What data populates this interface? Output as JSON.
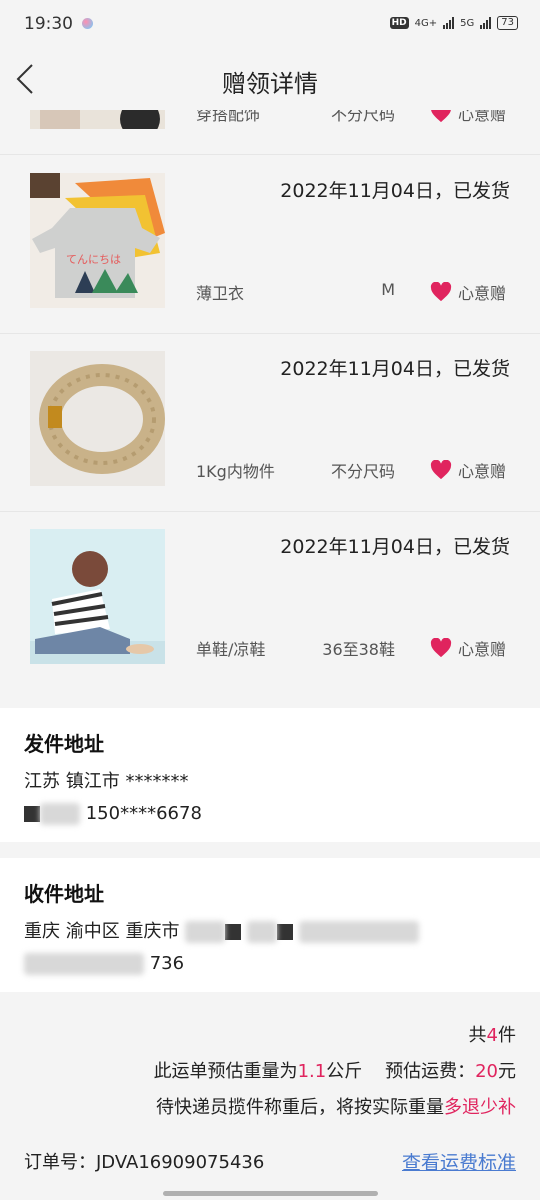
{
  "status": {
    "time": "19:30",
    "hd": "HD",
    "net1": "4G+",
    "net2": "5G",
    "battery": "73"
  },
  "nav": {
    "title": "赠领详情"
  },
  "items": [
    {
      "date": "",
      "name": "穿搭配饰",
      "size": "不分尺码",
      "gift": "心意赠"
    },
    {
      "date": "2022年11月04日，已发货",
      "name": "薄卫衣",
      "size": "M",
      "gift": "心意赠"
    },
    {
      "date": "2022年11月04日，已发货",
      "name": "1Kg内物件",
      "size": "不分尺码",
      "gift": "心意赠"
    },
    {
      "date": "2022年11月04日，已发货",
      "name": "单鞋/凉鞋",
      "size": "36至38鞋",
      "gift": "心意赠"
    }
  ],
  "sender": {
    "title": "发件地址",
    "line1": "江苏 镇江市 *******",
    "phone": "150****6678"
  },
  "receiver": {
    "title": "收件地址",
    "line1": "重庆 渝中区 重庆市",
    "phone_tail": "736"
  },
  "summary": {
    "count_prefix": "共",
    "count": "4",
    "count_suffix": "件",
    "weight_prefix": "此运单预估重量为",
    "weight": "1.1",
    "weight_unit": "公斤",
    "fee_prefix": "预估运费：",
    "fee": "20",
    "fee_unit": "元",
    "note_prefix": "待快递员揽件称重后，将按实际重量",
    "note_highlight": "多退少补"
  },
  "order": {
    "label": "订单号：",
    "number": "JDVA16909075436"
  },
  "standard_link": "查看运费标准",
  "colors": {
    "accent": "#e0245e",
    "link": "#4a7bd0"
  }
}
